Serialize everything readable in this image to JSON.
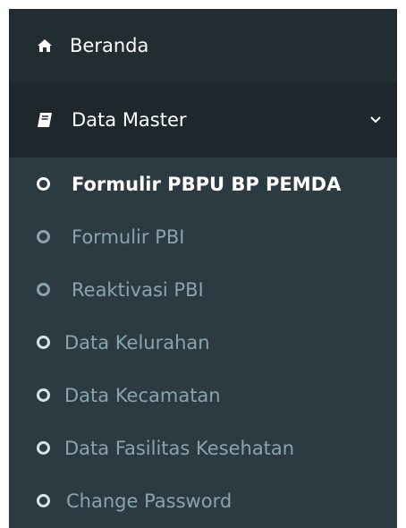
{
  "menu": {
    "home": {
      "label": "Beranda",
      "icon": "home-icon"
    },
    "master": {
      "label": "Data Master",
      "icon": "book-icon",
      "chevron": "chevron-down-icon"
    },
    "items": [
      {
        "label": "Formulir PBPU BP PEMDA",
        "active": true,
        "icon": "circle-icon"
      },
      {
        "label": "Formulir PBI",
        "icon": "circle-icon"
      },
      {
        "label": "Reaktivasi PBI",
        "icon": "circle-icon"
      },
      {
        "label": "Data Kelurahan",
        "icon": "circle-icon"
      },
      {
        "label": "Data Kecamatan",
        "icon": "circle-icon"
      },
      {
        "label": "Data Fasilitas Kesehatan",
        "icon": "circle-icon"
      },
      {
        "label": "Change Password",
        "icon": "circle-icon"
      }
    ]
  },
  "colors": {
    "sidebar_bg": "#2c3b41",
    "top_bg": "#222d32",
    "master_bg": "#1e282c",
    "muted_text": "#8aa4af",
    "active_text": "#ffffff"
  }
}
